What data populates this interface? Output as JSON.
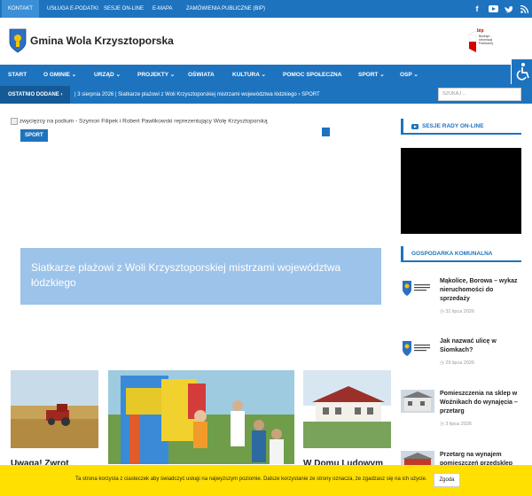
{
  "topbar": {
    "links": [
      "KONTAKT",
      "USŁUGA E-PODATKI",
      "SESJE ON-LINE",
      "E-MAPA",
      "ZAMÓWIENIA PUBLICZNE (BIP)"
    ],
    "social_icons": [
      "facebook-icon",
      "youtube-icon",
      "twitter-icon",
      "rss-icon"
    ]
  },
  "header": {
    "site_name": "Gmina Wola Krzysztoporska",
    "bip_brand": "bip",
    "bip_text": "Biuletyn Informacji Publicznej"
  },
  "nav": {
    "items": [
      "START",
      "O GMINIE ⌄",
      "URZĄD ⌄",
      "PROJEKTY ⌄",
      "OŚWIATA",
      "KULTURA ⌄",
      "POMOC SPOŁECZNA",
      "SPORT ⌄",
      "OSP ⌄"
    ]
  },
  "breaking": {
    "label": "OSTATNIO DODANE ›",
    "text": "| 3 sierpnia 2026 | Siatkarze plażowi z Woli Krzysztoporskiej mistrzami województwa łódzkiego › SPORT"
  },
  "search": {
    "placeholder": "SZUKAJ ..."
  },
  "feature": {
    "image_alt": "zwycięzcy na podium - Szymon Filipek i Robert Pawlikowski reprezentujący Wolę Krzysztoporską",
    "category": "SPORT",
    "title": "Siatkarze plażowi z Woli Krzysztoporskiej mistrzami województwa łódzkiego"
  },
  "sidebar": {
    "sessions_title": "SESJE RADY ON-LINE",
    "utilities_title": "GOSPODARKA KOMUNALNA",
    "news": [
      {
        "title": "Mąkolice, Borowa – wykaz nieruchomości do sprzedaży",
        "date": "31 lipca 2026"
      },
      {
        "title": "Jak nazwać ulicę w Siomkach?",
        "date": "29 lipca 2026"
      },
      {
        "title": "Pomieszczenia na sklep w Woźnikach do wynajęcia – przetarg",
        "date": "3 lipca 2026"
      },
      {
        "title": "Przetarg na wynajem pomieszczeń przedsklep w...",
        "date": ""
      }
    ]
  },
  "cards": [
    {
      "title": "Uwaga! Zwrot podatku"
    },
    {
      "title": ""
    },
    {
      "title": "W Domu Ludowym w"
    }
  ],
  "cookie": {
    "text": "Ta strona korzysta z ciasteczek aby świadczyć usługi na najwyższym poziomie. Dalsze korzystanie ze strony oznacza, że zgadzasz się na ich użycie.",
    "button": "Zgoda"
  },
  "colors": {
    "primary": "#1e73be",
    "cookie": "#ffe000"
  }
}
